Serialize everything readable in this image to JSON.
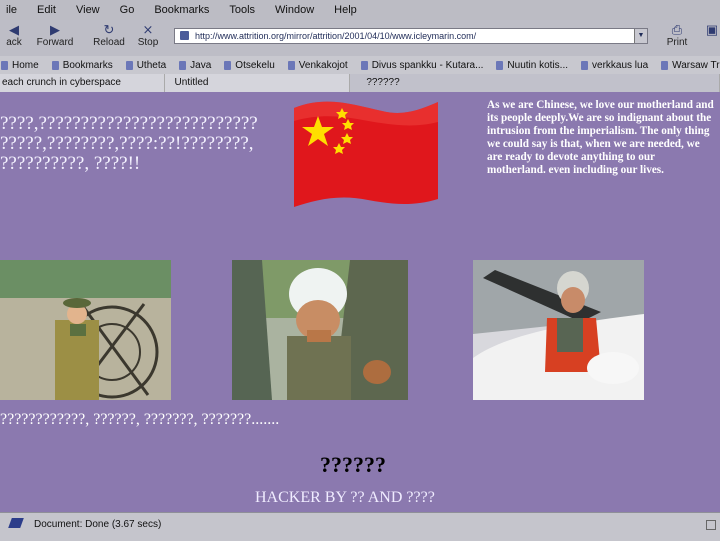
{
  "menu": [
    "ile",
    "Edit",
    "View",
    "Go",
    "Bookmarks",
    "Tools",
    "Window",
    "Help"
  ],
  "nav": {
    "back_label": "ack",
    "forward_label": "Forward",
    "reload_label": "Reload",
    "stop_label": "Stop",
    "print_label": "Print",
    "address": "http://www.attrition.org/mirror/attrition/2001/04/10/www.icleymarin.com/"
  },
  "bookmarks": [
    "Home",
    "Bookmarks",
    "Utheta",
    "Java",
    "Otsekelu",
    "Venkakojot",
    "Divus spankku - Kutara...",
    "Nuutin kotis...",
    "verkkaus lua",
    "Warsaw Travel Guide -"
  ],
  "tabs": [
    "each crunch in cyberspace",
    "Untitled",
    "??????"
  ],
  "content": {
    "chinese_line_1": "????,??????????????????????????",
    "chinese_line_2": "?????,????????,????:??!????????,",
    "chinese_line_3": "??????????,  ????!!",
    "declaration": "As we are Chinese, we love our motherland and its people deeply.We are so indignant about the intrusion from the imperialism. The only thing we could say is that, when we are needed, we are ready to devote anything to our motherland. even including our lives.",
    "line_2": "????????????, ??????, ???????, ???????.......",
    "signature": "??????",
    "credit": "HACKER BY ?? AND ????"
  },
  "status": {
    "text": "Document: Done (3.67 secs)"
  },
  "colors": {
    "page_bg": "#8b79af",
    "flag_red": "#e0171c",
    "star_yellow": "#ffde00"
  },
  "icons": [
    "back-arrow-icon",
    "forward-arrow-icon",
    "reload-icon",
    "stop-icon",
    "print-icon",
    "page-icon",
    "dropdown-icon",
    "bookmark-icon",
    "tab-page-icon",
    "status-icon"
  ]
}
